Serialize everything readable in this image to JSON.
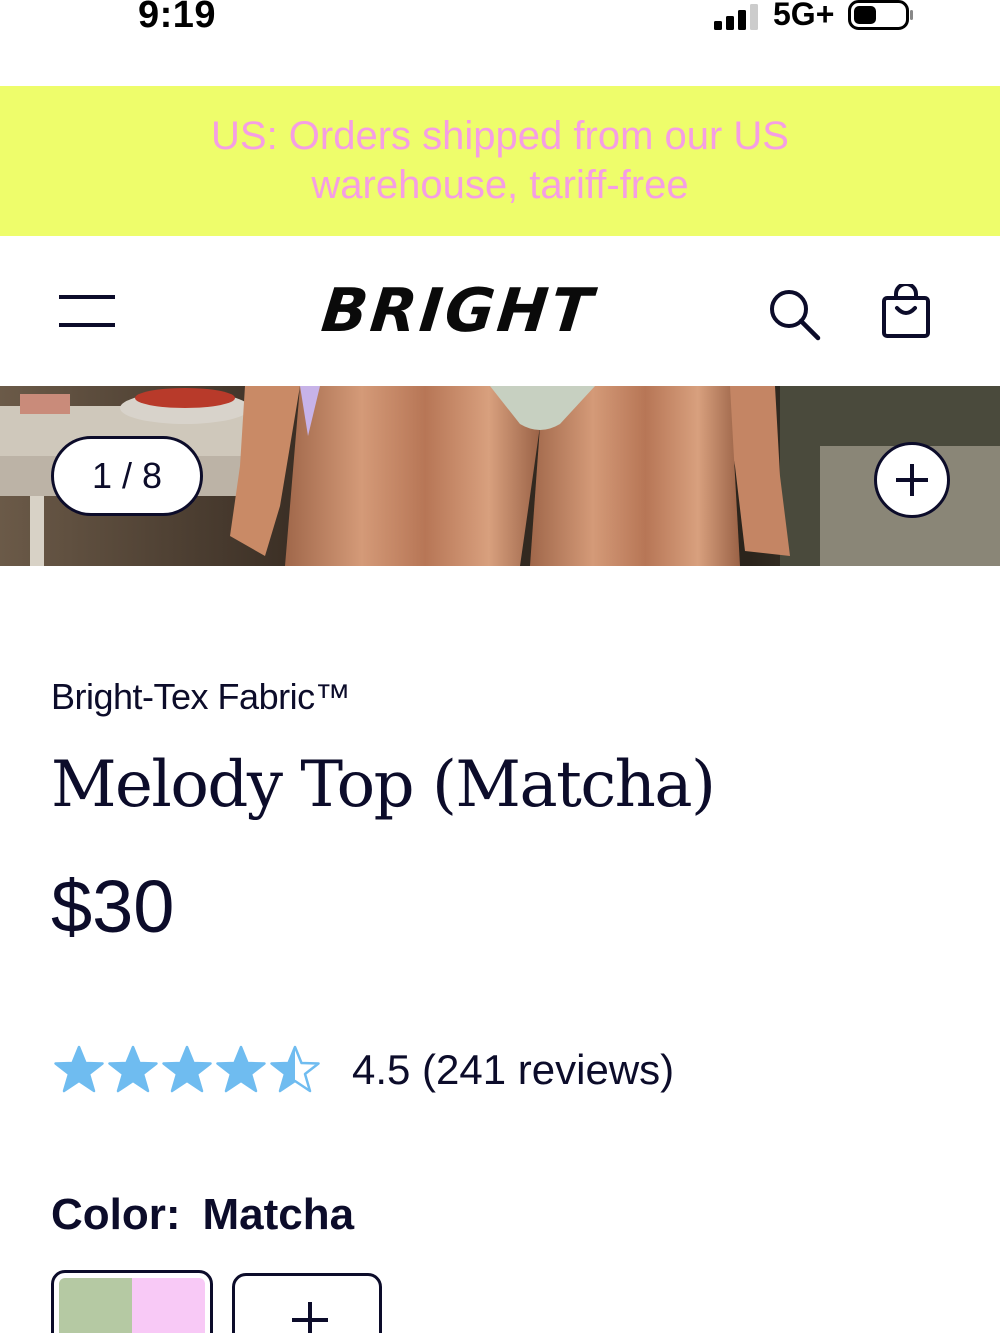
{
  "status_bar": {
    "time": "9:19",
    "network": "5G+"
  },
  "announcement": {
    "text": "US: Orders shipped from our US warehouse, tariff-free",
    "background": "#eefd6b",
    "text_color": "#f59ee4"
  },
  "header": {
    "logo": "BRIGHT",
    "menu_icon": "hamburger-icon",
    "search_icon": "search-icon",
    "cart_icon": "shopping-bag-icon"
  },
  "gallery": {
    "counter": "1 / 8",
    "zoom_icon": "plus-icon"
  },
  "product": {
    "fabric": "Bright-Tex Fabric™",
    "title": "Melody Top (Matcha)",
    "price": "$30",
    "rating": {
      "value": 4.5,
      "max": 5,
      "text": "4.5 (241 reviews)",
      "star_color": "#6fbcf0"
    },
    "color": {
      "label": "Color:",
      "value": "Matcha",
      "swatch_colors": [
        "#b5c9a3",
        "#f8c9f6"
      ]
    },
    "add_swatch_icon": "plus-icon"
  }
}
